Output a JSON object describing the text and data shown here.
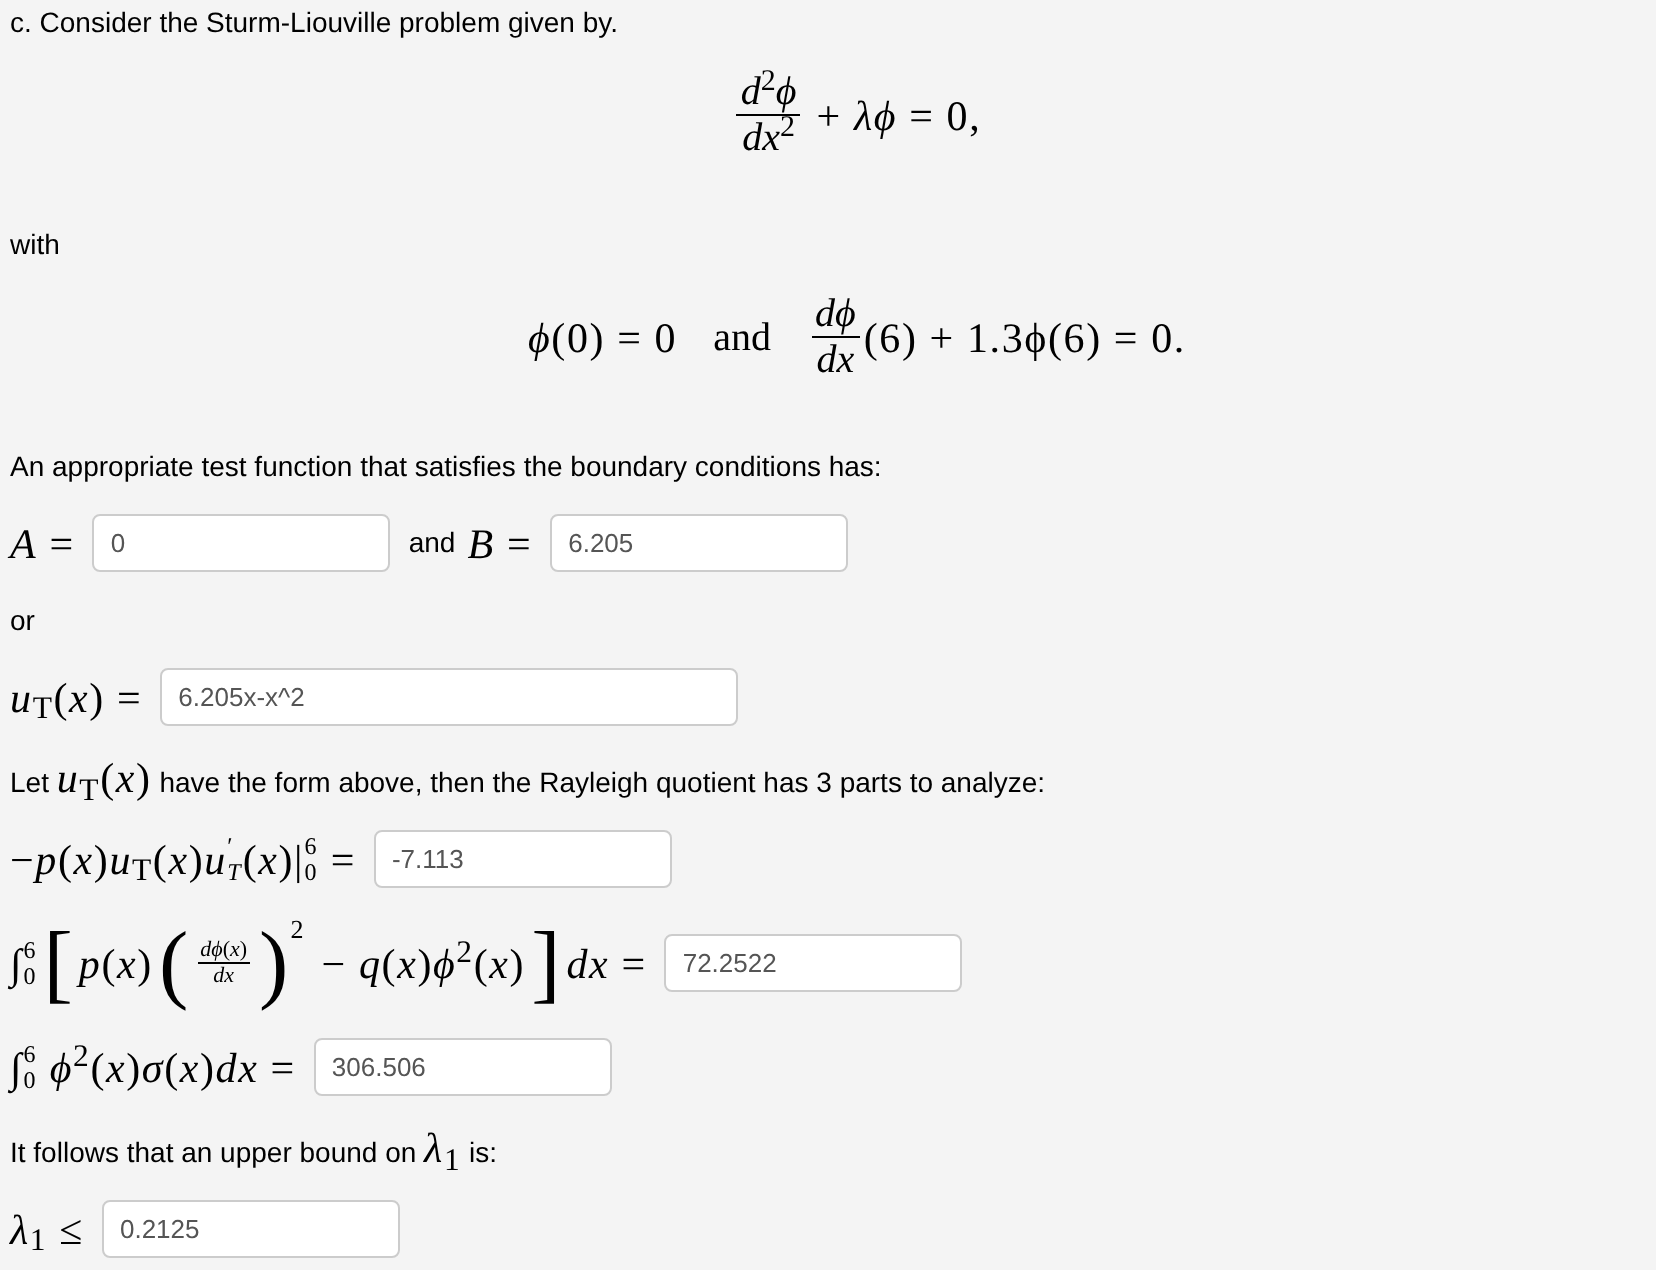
{
  "blocks": [
    {
      "kind": "paragraph",
      "parts": [
        {
          "kind": "text",
          "text": "c. Consider the Sturm-Liouville problem given by."
        }
      ]
    },
    {
      "kind": "display",
      "parts": [
        {
          "kind": "frac",
          "numerator": "*d*$^{2}$*ϕ*",
          "denominator": "*dx*$^{2}$"
        },
        {
          "kind": "math",
          "text": " + *λϕ* = 0,"
        }
      ]
    },
    {
      "kind": "paragraph",
      "parts": [
        {
          "kind": "text",
          "text": "with"
        }
      ]
    },
    {
      "kind": "display",
      "parts": [
        {
          "kind": "math",
          "text": "*ϕ*(0) = 0"
        },
        {
          "kind": "word",
          "text": "and"
        },
        {
          "kind": "frac",
          "numerator": "*dϕ*",
          "denominator": "*dx*"
        },
        {
          "kind": "math",
          "text": "(6) + 1.3ϕ(6) = 0."
        }
      ]
    },
    {
      "kind": "paragraph",
      "parts": [
        {
          "kind": "text",
          "text": "An appropriate test function that satisfies the boundary conditions has:"
        }
      ]
    },
    {
      "kind": "row",
      "parts": [
        {
          "kind": "math",
          "text": "*A* ="
        },
        {
          "kind": "field",
          "value": "0"
        },
        {
          "kind": "text",
          "text": "and"
        },
        {
          "kind": "math",
          "text": " *B* ="
        },
        {
          "kind": "field",
          "value": "6.205"
        }
      ]
    },
    {
      "kind": "paragraph",
      "parts": [
        {
          "kind": "text",
          "text": "or"
        }
      ]
    },
    {
      "kind": "row",
      "parts": [
        {
          "kind": "math",
          "text": "*u*$_{T}$(*x*) ="
        },
        {
          "kind": "wide_field",
          "value": "6.205x-x^2"
        }
      ]
    },
    {
      "kind": "paragraph",
      "parts": [
        {
          "kind": "text",
          "text": "Let "
        },
        {
          "kind": "math",
          "text": "*u*$_{T}$(*x*)"
        },
        {
          "kind": "text",
          "text": " have the form above, then the Rayleigh quotient has 3 parts to analyze:"
        }
      ]
    },
    {
      "kind": "row",
      "parts": [
        {
          "kind": "math",
          "text": "−*p*(*x*)*u*$_{T}$(*x*)"
        },
        {
          "kind": "limits",
          "base": "*u*",
          "upper": "′",
          "lower": "*T*"
        },
        {
          "kind": "math",
          "text": "(*x*)"
        },
        {
          "kind": "limits",
          "base": "|",
          "upper": "6",
          "lower": "0"
        },
        {
          "kind": "math",
          "text": " ="
        },
        {
          "kind": "field",
          "value": "-7.113"
        }
      ]
    },
    {
      "kind": "row",
      "parts": [
        {
          "kind": "limits",
          "base": "∫",
          "upper": "6",
          "lower": "0"
        },
        {
          "kind": "big",
          "text": "["
        },
        {
          "kind": "math",
          "text": "*p*(*x*)"
        },
        {
          "kind": "big",
          "text": "("
        },
        {
          "kind": "small_frac",
          "numerator": "*dϕ*(*x*)",
          "denominator": "*dx*"
        },
        {
          "kind": "big",
          "text": ")",
          "sup": "2"
        },
        {
          "kind": "math",
          "text": " − *q*(*x*)*ϕ*$^{2}$(*x*)"
        },
        {
          "kind": "big",
          "text": "]"
        },
        {
          "kind": "math",
          "text": "*dx* ="
        },
        {
          "kind": "field",
          "value": "72.2522"
        }
      ]
    },
    {
      "kind": "row",
      "parts": [
        {
          "kind": "limits",
          "base": "∫",
          "upper": "6",
          "lower": "0"
        },
        {
          "kind": "math",
          "text": " *ϕ*$^{2}$(*x*)*σ*(*x*)*dx* ="
        },
        {
          "kind": "field",
          "value": "306.506"
        }
      ]
    },
    {
      "kind": "paragraph",
      "parts": [
        {
          "kind": "text",
          "text": "It follows that an upper bound on "
        },
        {
          "kind": "math",
          "text": "*λ*$_{1}$"
        },
        {
          "kind": "text",
          "text": " is:"
        }
      ]
    },
    {
      "kind": "row",
      "parts": [
        {
          "kind": "math",
          "text": "*λ*$_{1}$ ≤"
        },
        {
          "kind": "field",
          "value": "0.2125"
        }
      ]
    }
  ]
}
